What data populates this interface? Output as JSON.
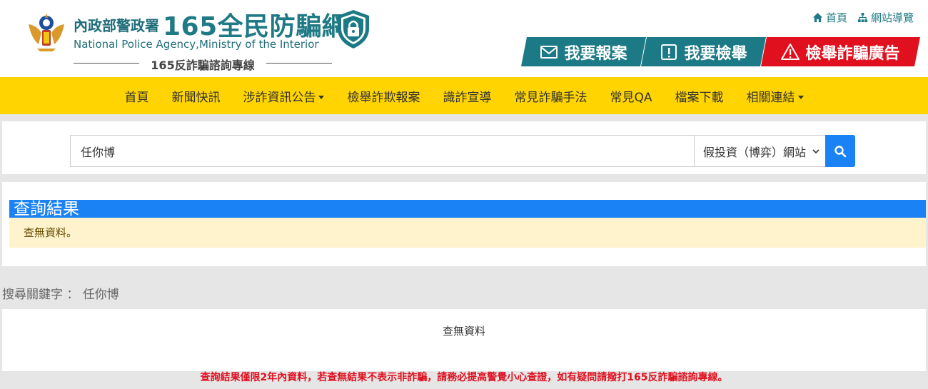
{
  "header": {
    "agency_zh": "內政部警政署",
    "site_name": "165全民防騙網",
    "agency_en": "National Police Agency,Ministry of the Interior",
    "hotline": "165反詐騙諮詢專線"
  },
  "toplinks": {
    "home": "首頁",
    "sitemap": "網站導覽"
  },
  "actions": {
    "report": "我要報案",
    "tip": "我要檢舉",
    "ad_report": "檢舉詐騙廣告"
  },
  "nav": {
    "items": [
      {
        "label": "首頁"
      },
      {
        "label": "新聞快訊"
      },
      {
        "label": "涉詐資訊公告"
      },
      {
        "label": "檢舉詐欺報案"
      },
      {
        "label": "識詐宣導"
      },
      {
        "label": "常見詐騙手法"
      },
      {
        "label": "常見QA"
      },
      {
        "label": "檔案下載"
      },
      {
        "label": "相關連結"
      }
    ]
  },
  "search": {
    "value": "任你博",
    "category": "假投資（博弈）網站"
  },
  "results": {
    "heading": "查詢結果",
    "message": "查無資料。"
  },
  "keyword": {
    "label": "搜尋關鍵字 ： 任你博"
  },
  "list": {
    "empty": "查無資料"
  },
  "disclaimer": "查詢結果僅限2年內資料，若查無結果不表示非詐騙，請務必提高警覺小心查證，如有疑問請撥打165反詐騙諮詢專線。",
  "colors": {
    "teal": "#1b7a86",
    "red": "#e0101f",
    "yellow": "#ffd400",
    "blue": "#1a82f5"
  }
}
